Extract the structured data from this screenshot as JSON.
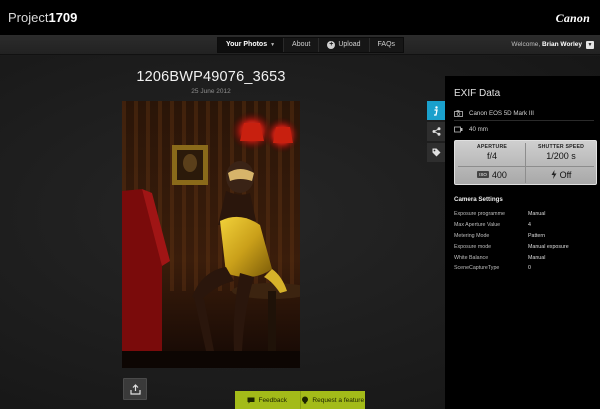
{
  "header": {
    "brand_prefix": "Project",
    "brand_number": "1709",
    "partner_logo": "Canon"
  },
  "nav": {
    "items": [
      {
        "label": "Your Photos",
        "active": true
      },
      {
        "label": "About",
        "active": false
      },
      {
        "label": "Upload",
        "active": false
      },
      {
        "label": "FAQs",
        "active": false
      }
    ],
    "welcome_prefix": "Welcome,",
    "user_name": "Brian Worley"
  },
  "photo": {
    "title": "1206BWP49076_3653",
    "date": "25 June 2012"
  },
  "footer": {
    "feedback_label": "Feedback",
    "request_label": "Request a feature",
    "accent": "#a3bb19"
  },
  "side_tabs": [
    {
      "icon": "info-icon",
      "active": true
    },
    {
      "icon": "share-icon",
      "active": false
    },
    {
      "icon": "tag-icon",
      "active": false
    }
  ],
  "exif": {
    "title": "EXIF Data",
    "camera": "Canon EOS 5D Mark III",
    "focal_length": "40 mm",
    "aperture_label": "APERTURE",
    "aperture_value": "f/4",
    "shutter_label": "SHUTTER SPEED",
    "shutter_value": "1/200 s",
    "iso_badge": "ISO",
    "iso_value": "400",
    "flash_value": "Off",
    "camera_settings_title": "Camera Settings",
    "settings": [
      {
        "key": "Exposure programme",
        "value": "Manual"
      },
      {
        "key": "Max Aperture Value",
        "value": "4"
      },
      {
        "key": "Metering Mode",
        "value": "Pattern"
      },
      {
        "key": "Exposure mode",
        "value": "Manual exposure"
      },
      {
        "key": "White Balance",
        "value": "Manual"
      },
      {
        "key": "SceneCaptureType",
        "value": "0"
      }
    ],
    "accent": "#1aa0cc"
  }
}
